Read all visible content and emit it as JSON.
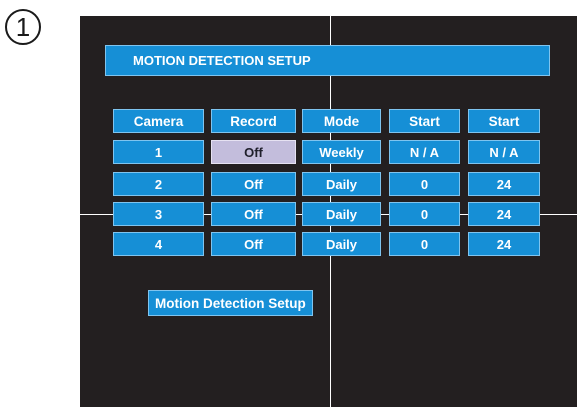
{
  "step_number": "1",
  "title": "MOTION DETECTION SETUP",
  "table": {
    "headers": [
      "Camera",
      "Record",
      "Mode",
      "Start",
      "Start"
    ],
    "rows": [
      [
        "1",
        "Off",
        "Weekly",
        "N / A",
        "N / A"
      ],
      [
        "2",
        "Off",
        "Daily",
        "0",
        "24"
      ],
      [
        "3",
        "Off",
        "Daily",
        "0",
        "24"
      ],
      [
        "4",
        "Off",
        "Daily",
        "0",
        "24"
      ]
    ]
  },
  "bottom_label": "Motion Detection Setup",
  "colors": {
    "cell_fill": "#168fd6",
    "selected_fill": "#c3bddc",
    "screen_background": "#231f20"
  }
}
